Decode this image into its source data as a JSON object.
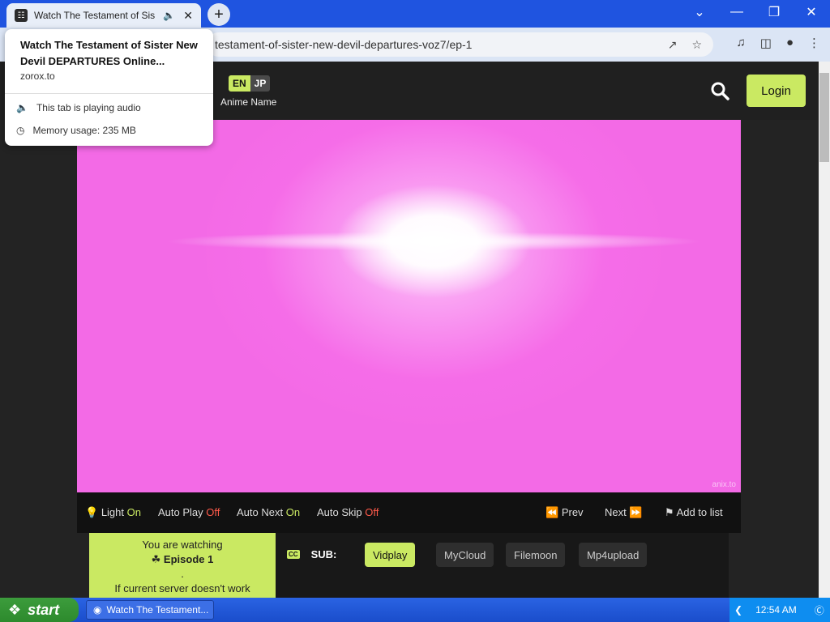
{
  "browser": {
    "tab_title": "Watch The Testament of Sist",
    "url": "testament-of-sister-new-devil-departures-voz7/ep-1"
  },
  "hovercard": {
    "title": "Watch The Testament of Sister New Devil DEPARTURES Online...",
    "host": "zorox.to",
    "audio": "This tab is playing audio",
    "memory": "Memory usage: 235 MB"
  },
  "site": {
    "lang_en": "EN",
    "lang_jp": "JP",
    "anime_name": "Anime Name",
    "login": "Login"
  },
  "player": {
    "watermark": "anix.to"
  },
  "controls": {
    "light": "Light",
    "light_state": "On",
    "autoplay": "Auto Play",
    "autoplay_state": "Off",
    "autonext": "Auto Next",
    "autonext_state": "On",
    "autoskip": "Auto Skip",
    "autoskip_state": "Off",
    "prev": "Prev",
    "next": "Next",
    "add_to_list": "Add to list"
  },
  "servers": {
    "watching": "You are watching",
    "episode": "Episode 1",
    "dot": ".",
    "note": "If current server doesn't work",
    "cc": "CC",
    "sub": "SUB:",
    "list": [
      "Vidplay",
      "MyCloud",
      "Filemoon",
      "Mp4upload"
    ],
    "active": "Vidplay"
  },
  "taskbar": {
    "start": "start",
    "task": "Watch The Testament...",
    "time": "12:54 AM"
  },
  "colors": {
    "accent": "#cae962",
    "off": "#ff5a4a",
    "video": "#f36ae6"
  }
}
